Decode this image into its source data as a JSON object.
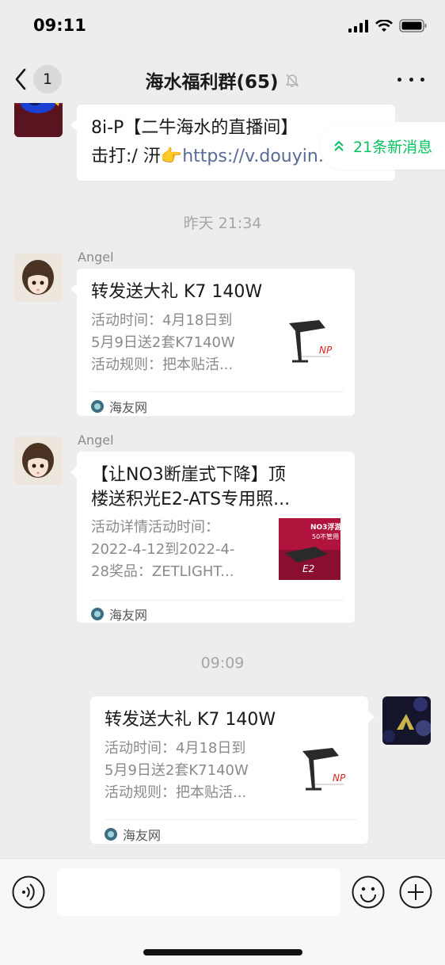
{
  "status_bar": {
    "time": "09:11"
  },
  "nav": {
    "back_count": "1",
    "title": "海水福利群(65)"
  },
  "new_messages": {
    "label": "21条新消息"
  },
  "messages": {
    "m0": {
      "line1": "8i-P【二牛海水的直播间】",
      "line2_text": "击打:/ 汧👉",
      "line2_link": "https://v.douyin.com"
    },
    "ts1": "昨天 21:34",
    "m1": {
      "sender": "Angel",
      "title": "转发送大礼 K7 140W",
      "desc": [
        "活动时间：4月18日到",
        "5月9日送2套K7140W",
        "活动规则：把本贴活..."
      ],
      "source": "海友网"
    },
    "m2": {
      "sender": "Angel",
      "title": [
        "【让NO3断崖式下降】顶",
        "楼送积光E2-ATS专用照..."
      ],
      "desc": [
        "活动详情活动时间：",
        "2022-4-12到2022-4-",
        "28奖品：ZETLIGHT..."
      ],
      "thumb_text": [
        "NO3浮游",
        "50不管用",
        "E2"
      ],
      "source": "海友网"
    },
    "ts2": "09:09",
    "m3": {
      "title": "转发送大礼 K7 140W",
      "desc": [
        "活动时间：4月18日到",
        "5月9日送2套K7140W",
        "活动规则：把本贴活..."
      ],
      "source": "海友网"
    }
  },
  "icons": {
    "back": "chevron-left-icon",
    "mute": "bell-muted-icon",
    "more": "more-icon",
    "voice": "voice-icon",
    "emoji": "emoji-icon",
    "plus": "plus-icon",
    "new_msg": "double-chevron-up-icon"
  },
  "colors": {
    "accent": "#07c160",
    "link": "#576b95",
    "background": "#ededed"
  }
}
